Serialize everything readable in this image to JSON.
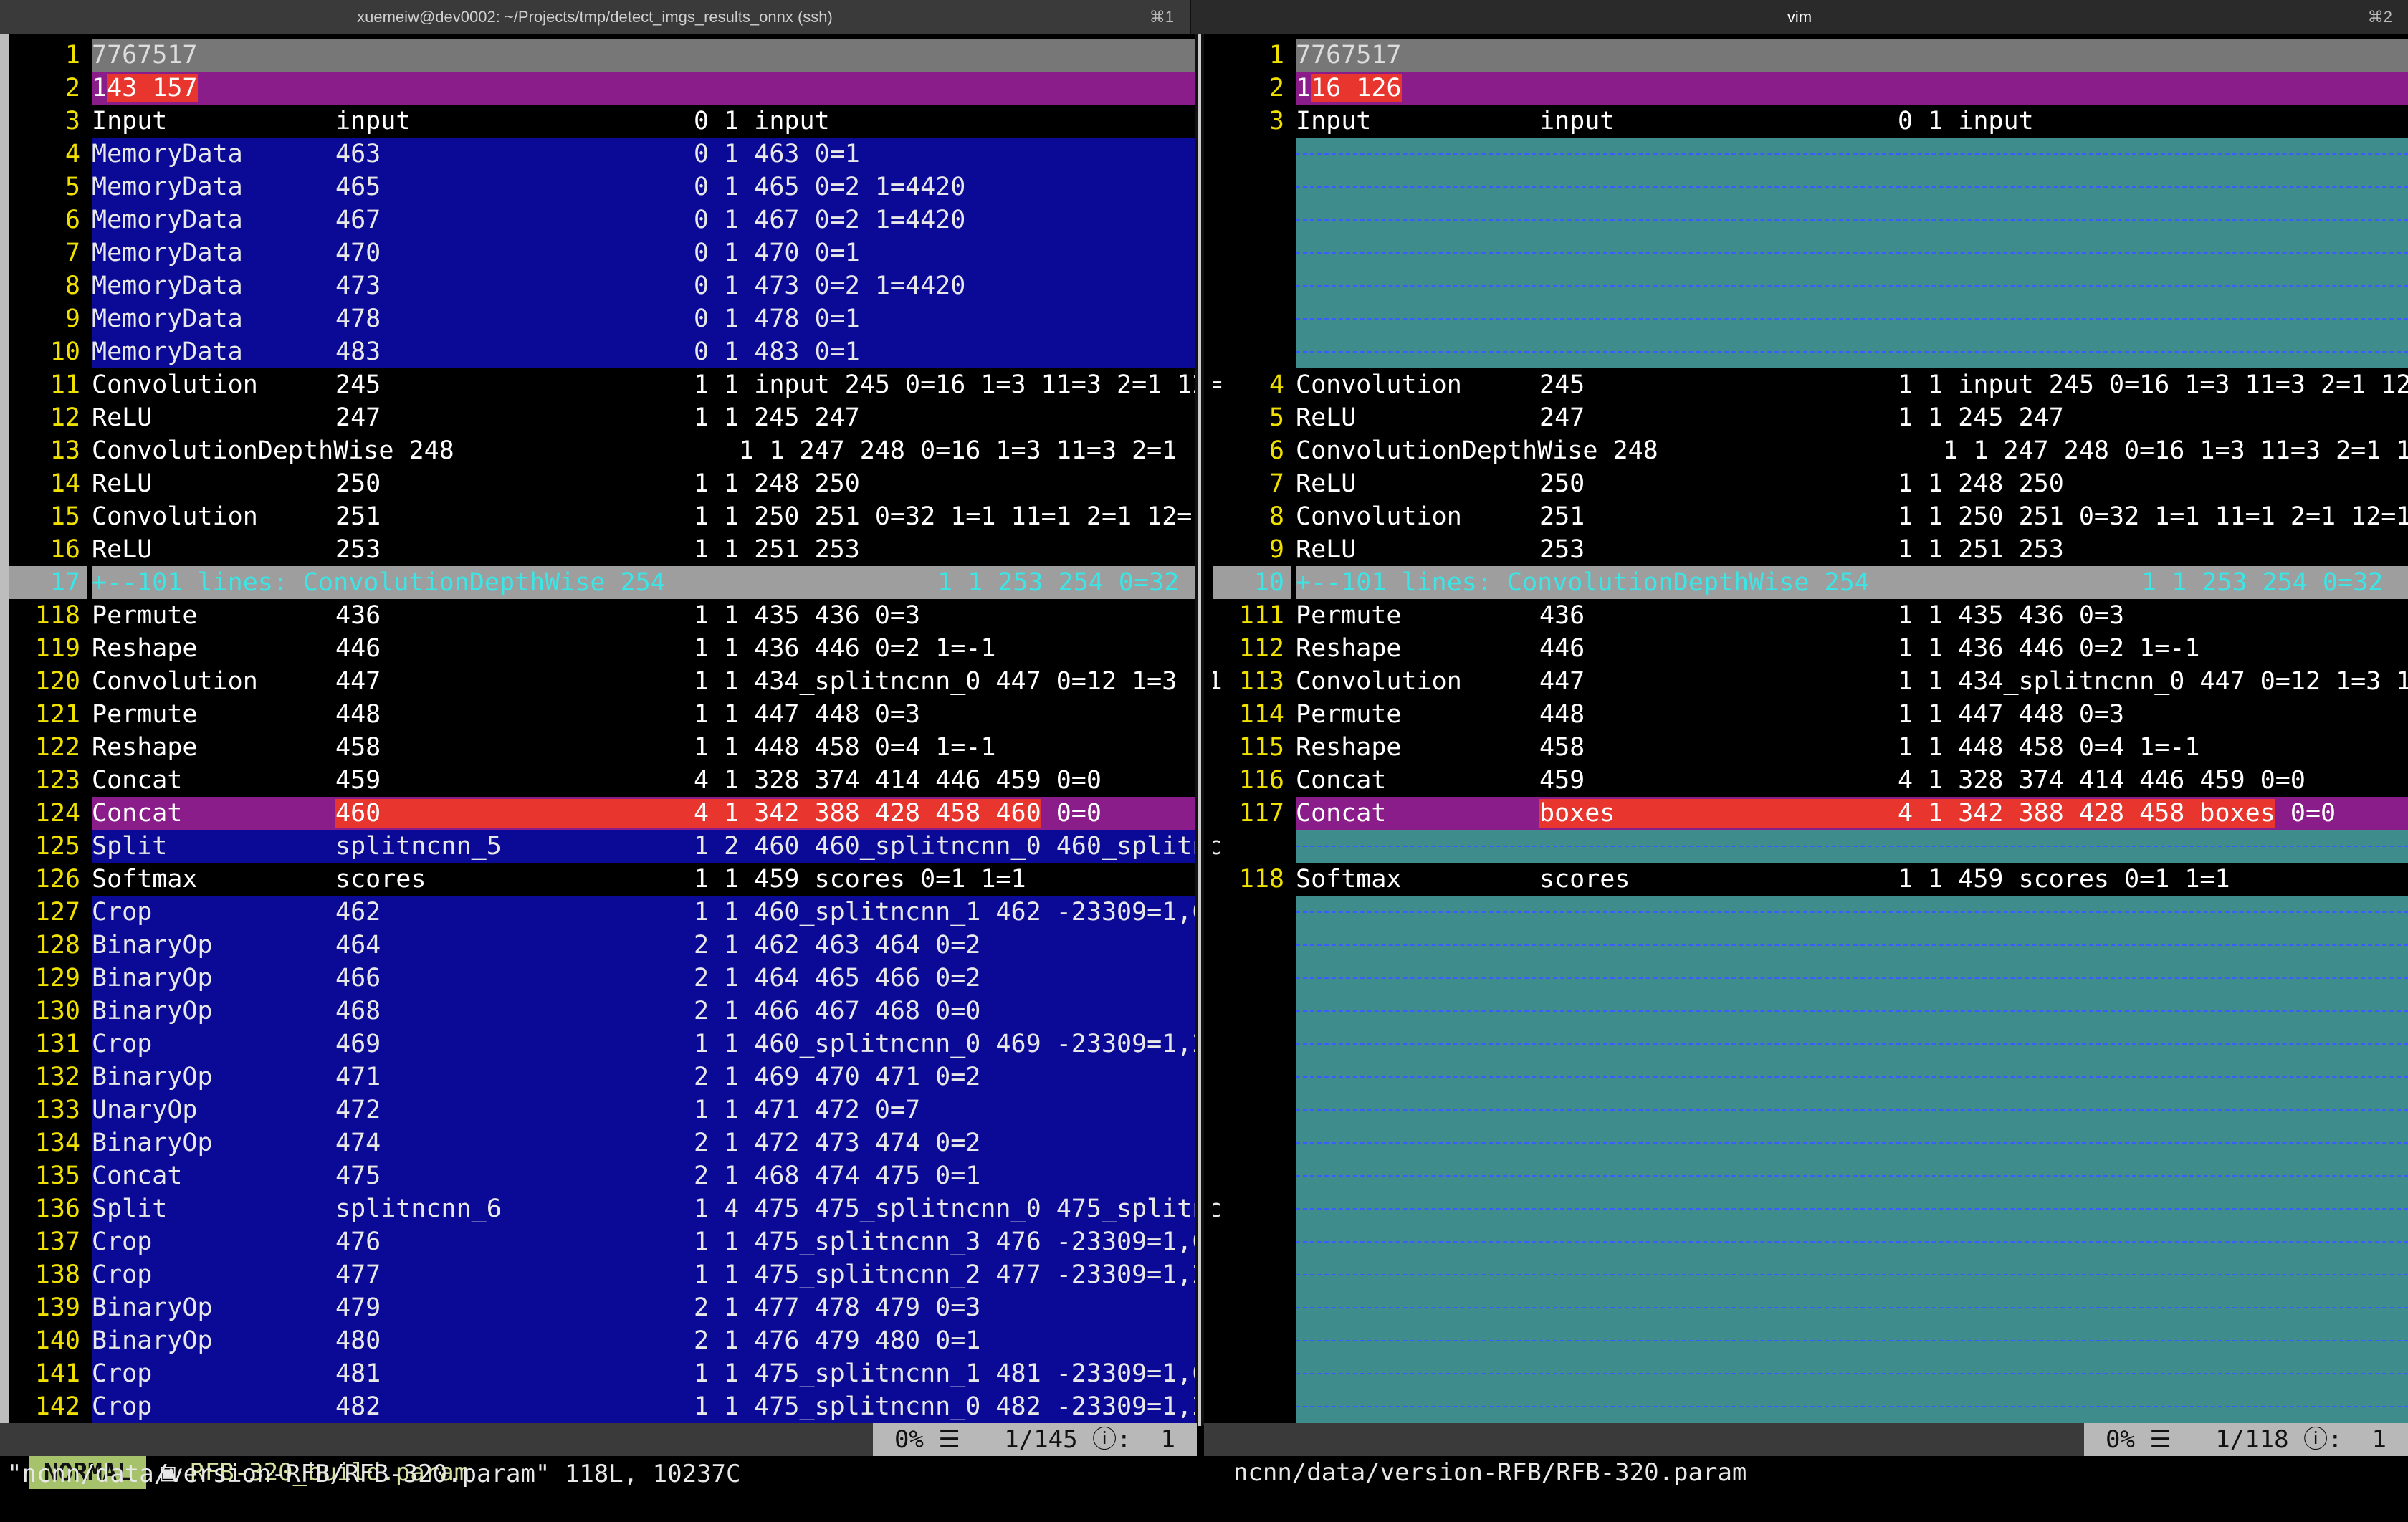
{
  "tabs": [
    {
      "title": "xuemeiw@dev0002: ~/Projects/tmp/detect_imgs_results_onnx (ssh)",
      "shortcut": "⌘1"
    },
    {
      "title": "vim",
      "shortcut": "⌘2"
    }
  ],
  "left": {
    "lines": [
      {
        "n": "1",
        "t": "7767517",
        "s": "grey1"
      },
      {
        "n": "2",
        "t": "143 157",
        "s": "purple"
      },
      {
        "n": "3",
        "c": [
          "Input",
          "input",
          "0 1 input"
        ],
        "s": ""
      },
      {
        "n": "4",
        "c": [
          "MemoryData",
          "463",
          "0 1 463 0=1"
        ],
        "s": "blue"
      },
      {
        "n": "5",
        "c": [
          "MemoryData",
          "465",
          "0 1 465 0=2 1=4420"
        ],
        "s": "blue"
      },
      {
        "n": "6",
        "c": [
          "MemoryData",
          "467",
          "0 1 467 0=2 1=4420"
        ],
        "s": "blue"
      },
      {
        "n": "7",
        "c": [
          "MemoryData",
          "470",
          "0 1 470 0=1"
        ],
        "s": "blue"
      },
      {
        "n": "8",
        "c": [
          "MemoryData",
          "473",
          "0 1 473 0=2 1=4420"
        ],
        "s": "blue"
      },
      {
        "n": "9",
        "c": [
          "MemoryData",
          "478",
          "0 1 478 0=1"
        ],
        "s": "blue"
      },
      {
        "n": "10",
        "c": [
          "MemoryData",
          "483",
          "0 1 483 0=1"
        ],
        "s": "blue"
      },
      {
        "n": "11",
        "c": [
          "Convolution",
          "245",
          "1 1 input 245 0=16 1=3 11=3 2=1 12="
        ],
        "s": ""
      },
      {
        "n": "12",
        "c": [
          "ReLU",
          "247",
          "1 1 245 247"
        ],
        "s": ""
      },
      {
        "n": "13",
        "c": [
          "ConvolutionDepthWise 248",
          "",
          "   1 1 247 248 0=16 1=3 11=3 2=1 1"
        ],
        "s": ""
      },
      {
        "n": "14",
        "c": [
          "ReLU",
          "250",
          "1 1 248 250"
        ],
        "s": ""
      },
      {
        "n": "15",
        "c": [
          "Convolution",
          "251",
          "1 1 250 251 0=32 1=1 11=1 2=1 12=1"
        ],
        "s": ""
      },
      {
        "n": "16",
        "c": [
          "ReLU",
          "253",
          "1 1 251 253"
        ],
        "s": ""
      },
      {
        "n": "17",
        "t": "+--101 lines: ConvolutionDepthWise 254                  1 1 253 254 0=32",
        "s": "fold"
      },
      {
        "n": "118",
        "c": [
          "Permute",
          "436",
          "1 1 435 436 0=3"
        ],
        "s": ""
      },
      {
        "n": "119",
        "c": [
          "Reshape",
          "446",
          "1 1 436 446 0=2 1=-1"
        ],
        "s": ""
      },
      {
        "n": "120",
        "c": [
          "Convolution",
          "447",
          "1 1 434_splitncnn_0 447 0=12 1=3 11"
        ],
        "s": ""
      },
      {
        "n": "121",
        "c": [
          "Permute",
          "448",
          "1 1 447 448 0=3"
        ],
        "s": ""
      },
      {
        "n": "122",
        "c": [
          "Reshape",
          "458",
          "1 1 448 458 0=4 1=-1"
        ],
        "s": ""
      },
      {
        "n": "123",
        "c": [
          "Concat",
          "459",
          "4 1 328 374 414 446 459 0=0"
        ],
        "s": ""
      },
      {
        "n": "124",
        "c": [
          "Concat",
          "460",
          "4 1 342 388 428 458 460 0=0"
        ],
        "s": "purple"
      },
      {
        "n": "125",
        "c": [
          "Split",
          "splitncnn_5",
          "1 2 460 460_splitncnn_0 460_splitnc"
        ],
        "s": "blue"
      },
      {
        "n": "126",
        "c": [
          "Softmax",
          "scores",
          "1 1 459 scores 0=1 1=1"
        ],
        "s": ""
      },
      {
        "n": "127",
        "c": [
          "Crop",
          "462",
          "1 1 460_splitncnn_1 462 -23309=1,0"
        ],
        "s": "blue"
      },
      {
        "n": "128",
        "c": [
          "BinaryOp",
          "464",
          "2 1 462 463 464 0=2"
        ],
        "s": "blue"
      },
      {
        "n": "129",
        "c": [
          "BinaryOp",
          "466",
          "2 1 464 465 466 0=2"
        ],
        "s": "blue"
      },
      {
        "n": "130",
        "c": [
          "BinaryOp",
          "468",
          "2 1 466 467 468 0=0"
        ],
        "s": "blue"
      },
      {
        "n": "131",
        "c": [
          "Crop",
          "469",
          "1 1 460_splitncnn_0 469 -23309=1,2"
        ],
        "s": "blue"
      },
      {
        "n": "132",
        "c": [
          "BinaryOp",
          "471",
          "2 1 469 470 471 0=2"
        ],
        "s": "blue"
      },
      {
        "n": "133",
        "c": [
          "UnaryOp",
          "472",
          "1 1 471 472 0=7"
        ],
        "s": "blue"
      },
      {
        "n": "134",
        "c": [
          "BinaryOp",
          "474",
          "2 1 472 473 474 0=2"
        ],
        "s": "blue"
      },
      {
        "n": "135",
        "c": [
          "Concat",
          "475",
          "2 1 468 474 475 0=1"
        ],
        "s": "blue"
      },
      {
        "n": "136",
        "c": [
          "Split",
          "splitncnn_6",
          "1 4 475 475_splitncnn_0 475_splitnc"
        ],
        "s": "blue"
      },
      {
        "n": "137",
        "c": [
          "Crop",
          "476",
          "1 1 475_splitncnn_3 476 -23309=1,0"
        ],
        "s": "blue"
      },
      {
        "n": "138",
        "c": [
          "Crop",
          "477",
          "1 1 475_splitncnn_2 477 -23309=1,2"
        ],
        "s": "blue"
      },
      {
        "n": "139",
        "c": [
          "BinaryOp",
          "479",
          "2 1 477 478 479 0=3"
        ],
        "s": "blue"
      },
      {
        "n": "140",
        "c": [
          "BinaryOp",
          "480",
          "2 1 476 479 480 0=1"
        ],
        "s": "blue"
      },
      {
        "n": "141",
        "c": [
          "Crop",
          "481",
          "1 1 475_splitncnn_1 481 -23309=1,0"
        ],
        "s": "blue"
      },
      {
        "n": "142",
        "c": [
          "Crop",
          "482",
          "1 1 475_splitncnn_0 482 -23309=1,2"
        ],
        "s": "blue"
      }
    ],
    "status": {
      "mode": "NORMAL",
      "file": "RFB-320_build.param",
      "percent": "0%",
      "pos": "1/145",
      "col": "1"
    }
  },
  "right": {
    "lines": [
      {
        "n": "1",
        "t": "7767517",
        "s": "grey1"
      },
      {
        "n": "2",
        "t": "116 126",
        "s": "purple"
      },
      {
        "n": "3",
        "c": [
          "Input",
          "input",
          "0 1 input"
        ],
        "s": ""
      },
      {
        "n": "",
        "s": "teal"
      },
      {
        "n": "",
        "s": "teal"
      },
      {
        "n": "",
        "s": "teal"
      },
      {
        "n": "",
        "s": "teal"
      },
      {
        "n": "",
        "s": "teal"
      },
      {
        "n": "",
        "s": "teal"
      },
      {
        "n": "",
        "s": "teal"
      },
      {
        "n": "4",
        "c": [
          "Convolution",
          "245",
          "1 1 input 245 0=16 1=3 11=3 2=1 12="
        ],
        "s": ""
      },
      {
        "n": "5",
        "c": [
          "ReLU",
          "247",
          "1 1 245 247"
        ],
        "s": ""
      },
      {
        "n": "6",
        "c": [
          "ConvolutionDepthWise 248",
          "",
          "   1 1 247 248 0=16 1=3 11=3 2=1 1"
        ],
        "s": ""
      },
      {
        "n": "7",
        "c": [
          "ReLU",
          "250",
          "1 1 248 250"
        ],
        "s": ""
      },
      {
        "n": "8",
        "c": [
          "Convolution",
          "251",
          "1 1 250 251 0=32 1=1 11=1 2=1 12=1"
        ],
        "s": ""
      },
      {
        "n": "9",
        "c": [
          "ReLU",
          "253",
          "1 1 251 253"
        ],
        "s": ""
      },
      {
        "n": "10",
        "t": "+--101 lines: ConvolutionDepthWise 254                  1 1 253 254 0=32",
        "s": "fold"
      },
      {
        "n": "111",
        "c": [
          "Permute",
          "436",
          "1 1 435 436 0=3"
        ],
        "s": ""
      },
      {
        "n": "112",
        "c": [
          "Reshape",
          "446",
          "1 1 436 446 0=2 1=-1"
        ],
        "s": ""
      },
      {
        "n": "113",
        "c": [
          "Convolution",
          "447",
          "1 1 434_splitncnn_0 447 0=12 1=3 11"
        ],
        "s": ""
      },
      {
        "n": "114",
        "c": [
          "Permute",
          "448",
          "1 1 447 448 0=3"
        ],
        "s": ""
      },
      {
        "n": "115",
        "c": [
          "Reshape",
          "458",
          "1 1 448 458 0=4 1=-1"
        ],
        "s": ""
      },
      {
        "n": "116",
        "c": [
          "Concat",
          "459",
          "4 1 328 374 414 446 459 0=0"
        ],
        "s": ""
      },
      {
        "n": "117",
        "c": [
          "Concat",
          "boxes",
          "4 1 342 388 428 458 boxes 0=0"
        ],
        "s": "purple"
      },
      {
        "n": "",
        "s": "teal"
      },
      {
        "n": "118",
        "c": [
          "Softmax",
          "scores",
          "1 1 459 scores 0=1 1=1"
        ],
        "s": ""
      },
      {
        "n": "",
        "s": "teal"
      },
      {
        "n": "",
        "s": "teal"
      },
      {
        "n": "",
        "s": "teal"
      },
      {
        "n": "",
        "s": "teal"
      },
      {
        "n": "",
        "s": "teal"
      },
      {
        "n": "",
        "s": "teal"
      },
      {
        "n": "",
        "s": "teal"
      },
      {
        "n": "",
        "s": "teal"
      },
      {
        "n": "",
        "s": "teal"
      },
      {
        "n": "",
        "s": "teal"
      },
      {
        "n": "",
        "s": "teal"
      },
      {
        "n": "",
        "s": "teal"
      },
      {
        "n": "",
        "s": "teal"
      },
      {
        "n": "",
        "s": "teal"
      },
      {
        "n": "",
        "s": "teal"
      },
      {
        "n": "",
        "s": "teal"
      }
    ],
    "status": {
      "file": "ncnn/data/version-RFB/RFB-320.param",
      "percent": "0%",
      "pos": "1/118",
      "col": "1"
    }
  },
  "cmdline": "\"ncnn/data/version-RFB/RFB-320.param\" 118L, 10237C"
}
